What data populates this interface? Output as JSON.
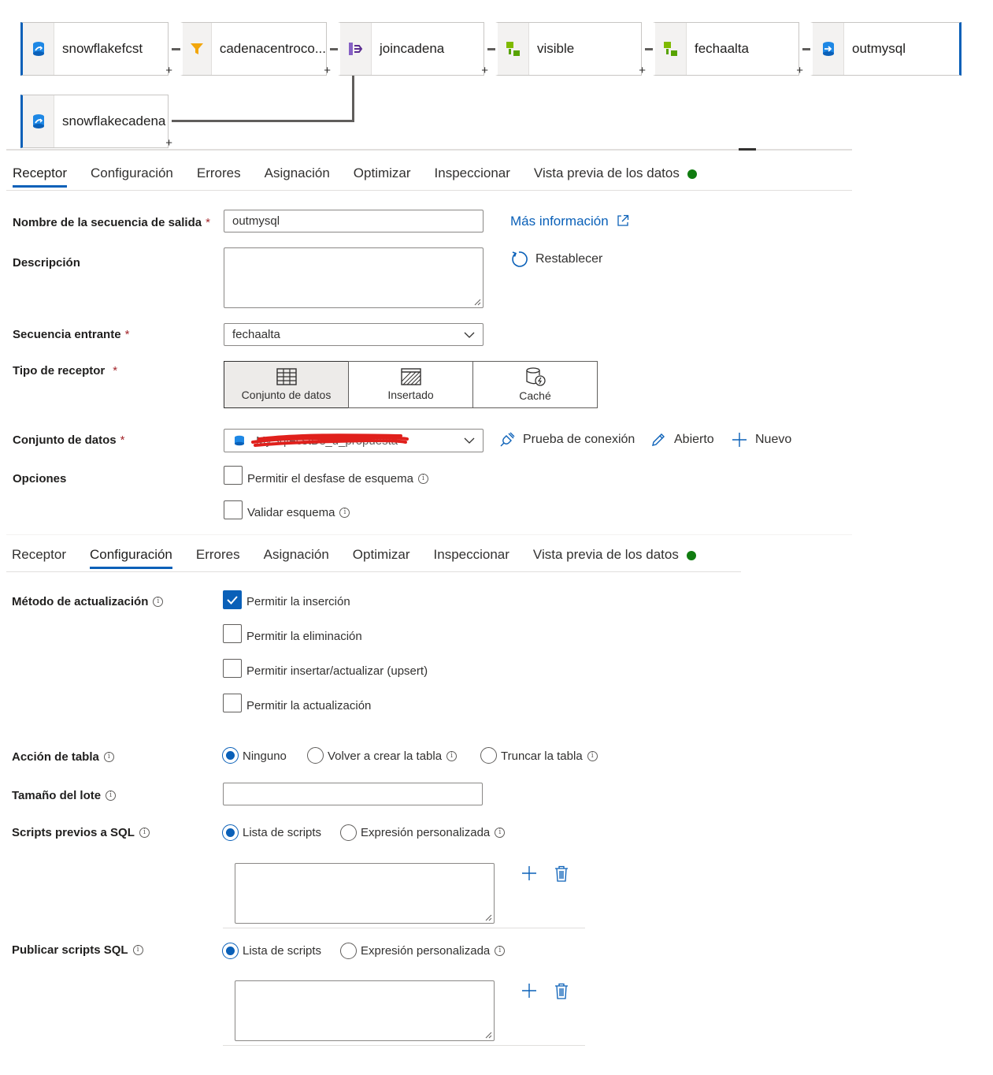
{
  "pipeline": {
    "nodes": [
      "snowflakefcst",
      "cadenacentroco...",
      "joincadena",
      "visible",
      "fechaalta",
      "outmysql",
      "snowflakecadena"
    ],
    "add_symbol": "+"
  },
  "tabs_top": [
    "Receptor",
    "Configuración",
    "Errores",
    "Asignación",
    "Optimizar",
    "Inspeccionar",
    "Vista previa de los datos"
  ],
  "tabs_bottom": [
    "Receptor",
    "Configuración",
    "Errores",
    "Asignación",
    "Optimizar",
    "Inspeccionar",
    "Vista previa de los datos"
  ],
  "sink": {
    "output_name_label": "Nombre de la secuencia de salida",
    "output_name_value": "outmysql",
    "description_label": "Descripción",
    "incoming_label": "Secuencia entrante",
    "incoming_value": "fechaalta",
    "sink_type_label": "Tipo de receptor",
    "sink_types": [
      "Conjunto de datos",
      "Insertado",
      "Caché"
    ],
    "dataset_label": "Conjunto de datos",
    "dataset_value": "MySqlFcstDs_d_propuesta",
    "options_label": "Opciones",
    "option_schema_drift": "Permitir el desfase de esquema",
    "option_validate_schema": "Validar esquema",
    "more_info": "Más información",
    "reset": "Restablecer",
    "test_connection": "Prueba de conexión",
    "open": "Abierto",
    "new": "Nuevo",
    "required_mark": "*"
  },
  "settings": {
    "update_method_label": "Método de actualización",
    "allow_insert": "Permitir la inserción",
    "allow_delete": "Permitir la eliminación",
    "allow_upsert": "Permitir insertar/actualizar (upsert)",
    "allow_update": "Permitir la actualización",
    "table_action_label": "Acción de tabla",
    "table_action_options": [
      "Ninguno",
      "Volver a crear la tabla",
      "Truncar la tabla"
    ],
    "batch_size_label": "Tamaño del lote",
    "pre_sql_label": "Scripts previos a SQL",
    "post_sql_label": "Publicar scripts SQL",
    "script_options": [
      "Lista de scripts",
      "Expresión personalizada"
    ]
  },
  "colors": {
    "accent": "#0a60b8",
    "status_green": "#107c10",
    "required": "#a4262c",
    "redaction": "#e0201c"
  }
}
